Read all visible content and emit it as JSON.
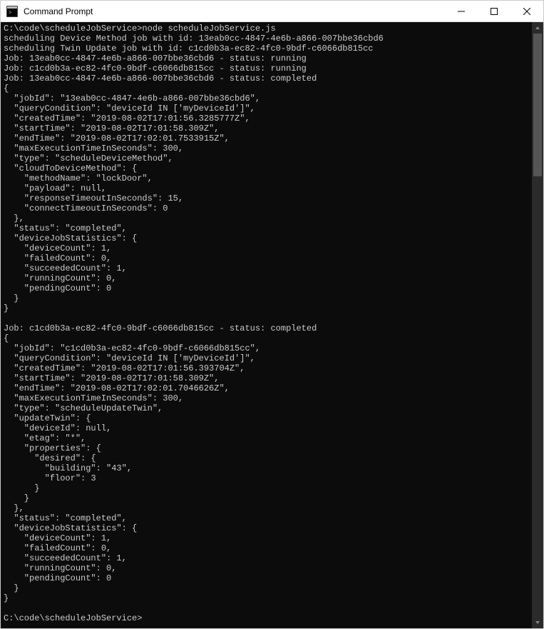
{
  "window": {
    "title": "Command Prompt"
  },
  "terminal": {
    "lines": [
      "C:\\code\\scheduleJobService>node scheduleJobService.js",
      "scheduling Device Method job with id: 13eab0cc-4847-4e6b-a866-007bbe36cbd6",
      "scheduling Twin Update job with id: c1cd0b3a-ec82-4fc0-9bdf-c6066db815cc",
      "Job: 13eab0cc-4847-4e6b-a866-007bbe36cbd6 - status: running",
      "Job: c1cd0b3a-ec82-4fc0-9bdf-c6066db815cc - status: running",
      "Job: 13eab0cc-4847-4e6b-a866-007bbe36cbd6 - status: completed",
      "{",
      "  \"jobId\": \"13eab0cc-4847-4e6b-a866-007bbe36cbd6\",",
      "  \"queryCondition\": \"deviceId IN ['myDeviceId']\",",
      "  \"createdTime\": \"2019-08-02T17:01:56.3285777Z\",",
      "  \"startTime\": \"2019-08-02T17:01:58.309Z\",",
      "  \"endTime\": \"2019-08-02T17:02:01.7533915Z\",",
      "  \"maxExecutionTimeInSeconds\": 300,",
      "  \"type\": \"scheduleDeviceMethod\",",
      "  \"cloudToDeviceMethod\": {",
      "    \"methodName\": \"lockDoor\",",
      "    \"payload\": null,",
      "    \"responseTimeoutInSeconds\": 15,",
      "    \"connectTimeoutInSeconds\": 0",
      "  },",
      "  \"status\": \"completed\",",
      "  \"deviceJobStatistics\": {",
      "    \"deviceCount\": 1,",
      "    \"failedCount\": 0,",
      "    \"succeededCount\": 1,",
      "    \"runningCount\": 0,",
      "    \"pendingCount\": 0",
      "  }",
      "}",
      "",
      "Job: c1cd0b3a-ec82-4fc0-9bdf-c6066db815cc - status: completed",
      "{",
      "  \"jobId\": \"c1cd0b3a-ec82-4fc0-9bdf-c6066db815cc\",",
      "  \"queryCondition\": \"deviceId IN ['myDeviceId']\",",
      "  \"createdTime\": \"2019-08-02T17:01:56.393704Z\",",
      "  \"startTime\": \"2019-08-02T17:01:58.309Z\",",
      "  \"endTime\": \"2019-08-02T17:02:01.7046626Z\",",
      "  \"maxExecutionTimeInSeconds\": 300,",
      "  \"type\": \"scheduleUpdateTwin\",",
      "  \"updateTwin\": {",
      "    \"deviceId\": null,",
      "    \"etag\": \"*\",",
      "    \"properties\": {",
      "      \"desired\": {",
      "        \"building\": \"43\",",
      "        \"floor\": 3",
      "      }",
      "    }",
      "  },",
      "  \"status\": \"completed\",",
      "  \"deviceJobStatistics\": {",
      "    \"deviceCount\": 1,",
      "    \"failedCount\": 0,",
      "    \"succeededCount\": 1,",
      "    \"runningCount\": 0,",
      "    \"pendingCount\": 0",
      "  }",
      "}",
      "",
      "C:\\code\\scheduleJobService>"
    ]
  }
}
